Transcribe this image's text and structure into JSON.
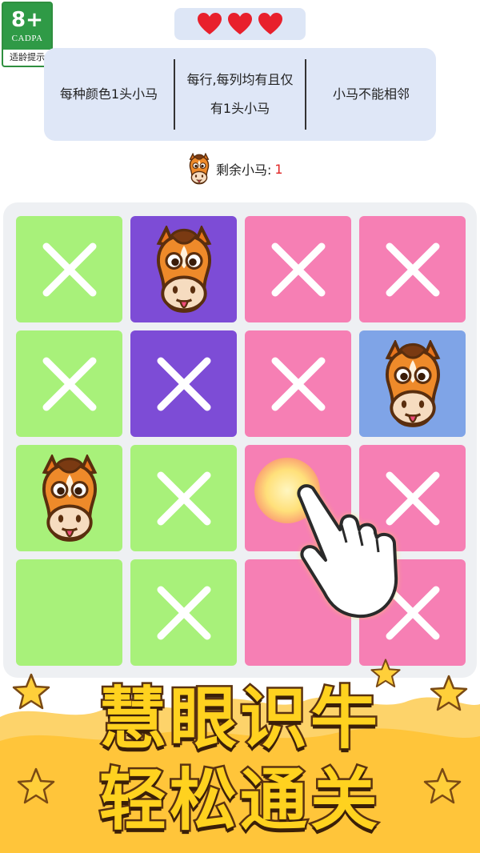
{
  "age_rating": {
    "age": "8+",
    "org": "CADPA",
    "tip": "适龄提示"
  },
  "lives": {
    "count": 3,
    "color": "#e8202c"
  },
  "rules": [
    "每种颜色1头小马",
    "每行,每列均有且仅有1头小马",
    "小马不能相邻"
  ],
  "status": {
    "label": "剩余小马: ",
    "count": "1"
  },
  "colors": {
    "green": "#a8f17a",
    "purple": "#7d4cd6",
    "pink": "#f67fb4",
    "blue": "#7fa4e7"
  },
  "board": [
    [
      {
        "color": "green",
        "mark": "x"
      },
      {
        "color": "purple",
        "mark": "horse"
      },
      {
        "color": "pink",
        "mark": "x"
      },
      {
        "color": "pink",
        "mark": "x"
      }
    ],
    [
      {
        "color": "green",
        "mark": "x"
      },
      {
        "color": "purple",
        "mark": "x"
      },
      {
        "color": "pink",
        "mark": "x"
      },
      {
        "color": "blue",
        "mark": "horse"
      }
    ],
    [
      {
        "color": "green",
        "mark": "horse"
      },
      {
        "color": "green",
        "mark": "x"
      },
      {
        "color": "pink",
        "mark": "none"
      },
      {
        "color": "pink",
        "mark": "x"
      }
    ],
    [
      {
        "color": "green",
        "mark": "none"
      },
      {
        "color": "green",
        "mark": "x"
      },
      {
        "color": "pink",
        "mark": "none"
      },
      {
        "color": "pink",
        "mark": "x"
      }
    ]
  ],
  "slogan": {
    "line1": "慧眼识牛",
    "line2": "轻松通关"
  }
}
